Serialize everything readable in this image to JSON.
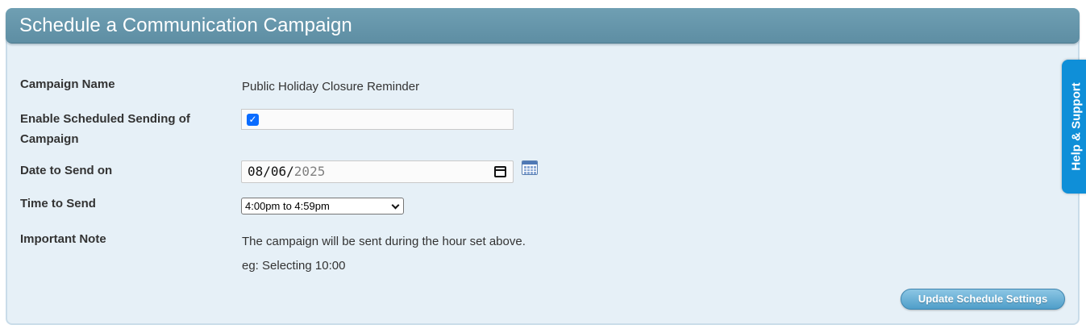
{
  "header": {
    "title": "Schedule a Communication Campaign"
  },
  "form": {
    "campaign_name_label": "Campaign Name",
    "campaign_name_value": "Public Holiday Closure Reminder",
    "enable_label_line1": "Enable Scheduled Sending of",
    "enable_label_line2": "Campaign",
    "enable_checked": true,
    "date_label": "Date to Send on",
    "date_value_mmdd": "08/06/",
    "date_value_year": "2025",
    "time_label": "Time to Send",
    "time_value": "4:00pm to 4:59pm",
    "note_label": "Important Note",
    "note_line1": "The campaign will be sent during the hour set above.",
    "note_line2": "eg: Selecting 10:00"
  },
  "actions": {
    "update_label": "Update Schedule Settings"
  },
  "help_tab": {
    "label": "Help & Support"
  },
  "icons": {
    "checkbox": "checkmark-icon",
    "date_picker": "calendar-icon",
    "calendar_button": "calendar-grid-icon",
    "select_arrow": "chevron-down-icon"
  },
  "colors": {
    "header_bg": "#6498ac",
    "panel_bg": "#e6f0f7",
    "help_tab_bg": "#0f8fd8",
    "button_bg": "#5ea9d3",
    "checkbox_blue": "#0a6cff"
  }
}
